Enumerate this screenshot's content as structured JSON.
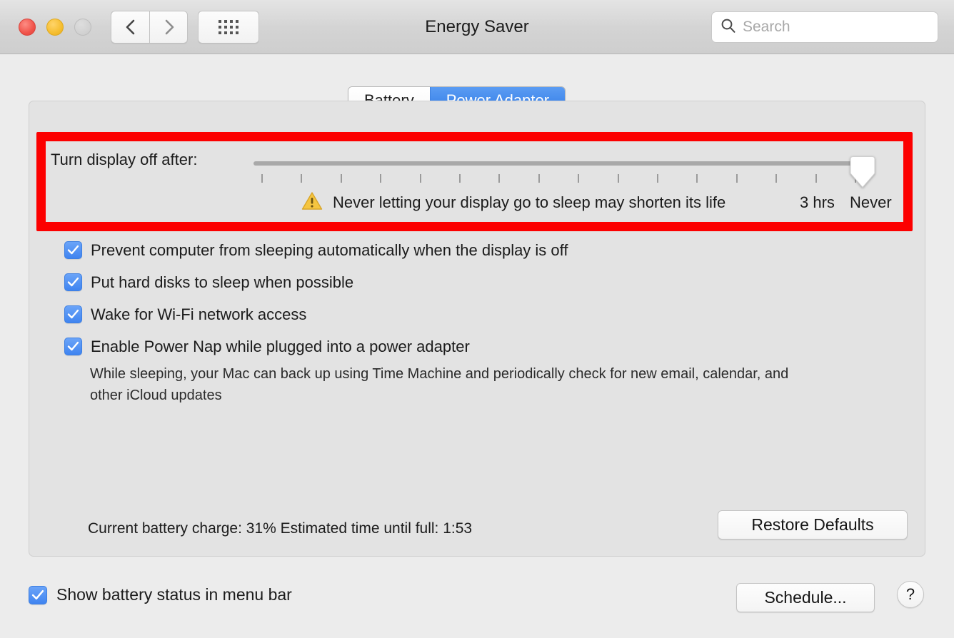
{
  "window": {
    "title": "Energy Saver",
    "traffic_lights": [
      "close",
      "minimize",
      "zoom"
    ],
    "nav": {
      "back_icon": "chevron-left-icon",
      "forward_icon": "chevron-right-icon",
      "grid_icon": "show-all-grid-icon"
    }
  },
  "search": {
    "placeholder": "Search",
    "value": "",
    "icon": "search-icon"
  },
  "tabs": [
    {
      "label": "Battery",
      "active": false
    },
    {
      "label": "Power Adapter",
      "active": true
    }
  ],
  "slider": {
    "label": "Turn display off after:",
    "tick_count": 16,
    "value": "Never",
    "position_percent": 100,
    "labels": [
      {
        "text": "3 hrs"
      },
      {
        "text": "Never"
      }
    ]
  },
  "warning": {
    "icon": "warning-triangle-icon",
    "text": "Never letting your display go to sleep may shorten its life"
  },
  "checkboxes": [
    {
      "label": "Prevent computer from sleeping automatically when the display is off",
      "checked": true
    },
    {
      "label": "Put hard disks to sleep when possible",
      "checked": true
    },
    {
      "label": "Wake for Wi-Fi network access",
      "checked": true
    },
    {
      "label": "Enable Power Nap while plugged into a power adapter",
      "checked": true
    }
  ],
  "power_nap_note": "While sleeping, your Mac can back up using Time Machine and periodically check for new email, calendar, and other iCloud updates",
  "status": {
    "battery_text": "Current battery charge: 31%  Estimated time until full: 1:53"
  },
  "buttons": {
    "restore_defaults": "Restore Defaults",
    "schedule": "Schedule...",
    "help": "?"
  },
  "footer": {
    "show_battery_label": "Show battery status in menu bar",
    "show_battery_checked": true
  },
  "colors": {
    "accent_blue": "#3f84f0",
    "tab_active_blue": "#2f7ae5",
    "annotation_red": "#fc0000",
    "warning_yellow": "#f3c02f",
    "window_bg": "#ececec",
    "panel_bg": "#e3e3e3"
  }
}
